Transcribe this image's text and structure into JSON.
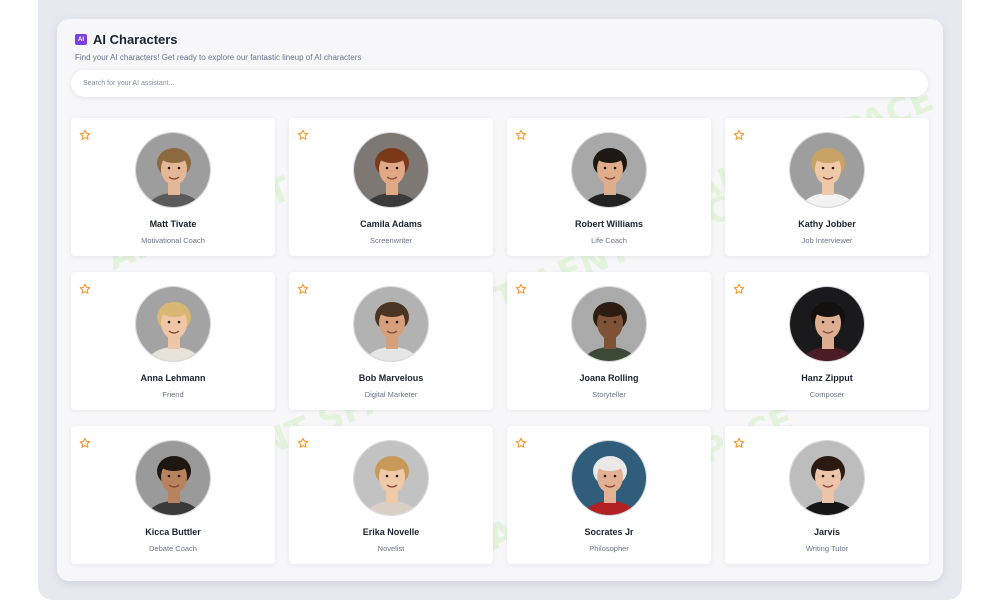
{
  "header": {
    "icon_text": "AI",
    "title": "AI Characters",
    "subtitle": "Find your AI characters! Get ready to explore our fantastic lineup of AI characters"
  },
  "search": {
    "placeholder": "Search for your AI assistant..."
  },
  "watermark": "AI TALENT SPACE",
  "colors": {
    "accent": "#7b3fe4",
    "star": "#f29b38",
    "background": "#e8e9f0",
    "panel": "#f7f7fa",
    "watermark": "#ccefb8"
  },
  "characters": [
    {
      "name": "Matt Tivate",
      "role": "Motivational Coach",
      "favorite": false,
      "bg": "#9d9d9d",
      "skin": "#e4b896",
      "hair": "#8a6a3e",
      "shirt": "#5a5a5a"
    },
    {
      "name": "Camila Adams",
      "role": "Screenwriter",
      "favorite": false,
      "bg": "#7d7873",
      "skin": "#e0a886",
      "hair": "#7a3a1a",
      "shirt": "#3a3a3a"
    },
    {
      "name": "Robert Williams",
      "role": "Life Coach",
      "favorite": false,
      "bg": "#a8a8a8",
      "skin": "#deae8c",
      "hair": "#1e1812",
      "shirt": "#222222"
    },
    {
      "name": "Kathy Jobber",
      "role": "Job Interviewer",
      "favorite": false,
      "bg": "#9e9e9e",
      "skin": "#efc8a8",
      "hair": "#c9a266",
      "shirt": "#f2f2f2"
    },
    {
      "name": "Anna Lehmann",
      "role": "Friend",
      "favorite": false,
      "bg": "#a3a3a3",
      "skin": "#efc7a6",
      "hair": "#d8b774",
      "shirt": "#e8e2d8"
    },
    {
      "name": "Bob Marvelous",
      "role": "Digital Marketer",
      "favorite": false,
      "bg": "#b2b2b2",
      "skin": "#d6a07c",
      "hair": "#4a3422",
      "shirt": "#e5e5e5"
    },
    {
      "name": "Joana Rolling",
      "role": "Storyteller",
      "favorite": false,
      "bg": "#aaaaaa",
      "skin": "#7e5236",
      "hair": "#2c1c12",
      "shirt": "#3b4a36"
    },
    {
      "name": "Hanz Zipput",
      "role": "Composer",
      "favorite": false,
      "bg": "#1a1a1c",
      "skin": "#dcae92",
      "hair": "#14100e",
      "shirt": "#4a1c24"
    },
    {
      "name": "Kicca Buttler",
      "role": "Debate Coach",
      "favorite": false,
      "bg": "#9a9a9a",
      "skin": "#b8825e",
      "hair": "#1e1610",
      "shirt": "#3a3a3a"
    },
    {
      "name": "Erika Novelle",
      "role": "Novelist",
      "favorite": false,
      "bg": "#c2c2c2",
      "skin": "#f0c9a8",
      "hair": "#c79a5a",
      "shirt": "#d8d0c4"
    },
    {
      "name": "Socrates Jr",
      "role": "Philosopher",
      "favorite": false,
      "bg": "#2f5d7a",
      "skin": "#e4b094",
      "hair": "#e9e9e9",
      "shirt": "#b22222"
    },
    {
      "name": "Jarvis",
      "role": "Writing Tutor",
      "favorite": false,
      "bg": "#bdbdbd",
      "skin": "#ecc4a8",
      "hair": "#2a1a12",
      "shirt": "#161616"
    }
  ]
}
